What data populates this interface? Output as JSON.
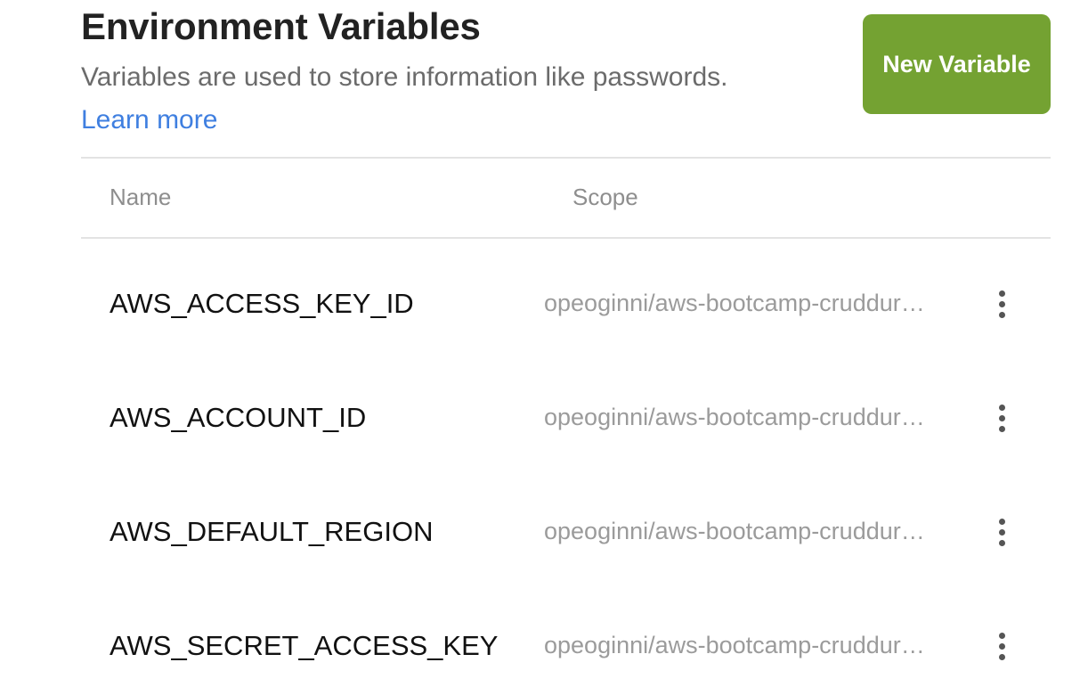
{
  "header": {
    "title": "Environment Variables",
    "description": "Variables are used to store information like passwords.",
    "learn_more": "Learn more",
    "new_variable_button": "New Variable",
    "button_color": "#74a232",
    "link_color": "#3f7fe0"
  },
  "table": {
    "columns": {
      "name": "Name",
      "scope": "Scope"
    },
    "rows": [
      {
        "name": "AWS_ACCESS_KEY_ID",
        "scope": "opeoginni/aws-bootcamp-cruddur…",
        "menu_icon": "more-vertical-icon"
      },
      {
        "name": "AWS_ACCOUNT_ID",
        "scope": "opeoginni/aws-bootcamp-cruddur…",
        "menu_icon": "more-vertical-icon"
      },
      {
        "name": "AWS_DEFAULT_REGION",
        "scope": "opeoginni/aws-bootcamp-cruddur…",
        "menu_icon": "more-vertical-icon"
      },
      {
        "name": "AWS_SECRET_ACCESS_KEY",
        "scope": "opeoginni/aws-bootcamp-cruddur…",
        "menu_icon": "more-vertical-icon"
      }
    ]
  }
}
